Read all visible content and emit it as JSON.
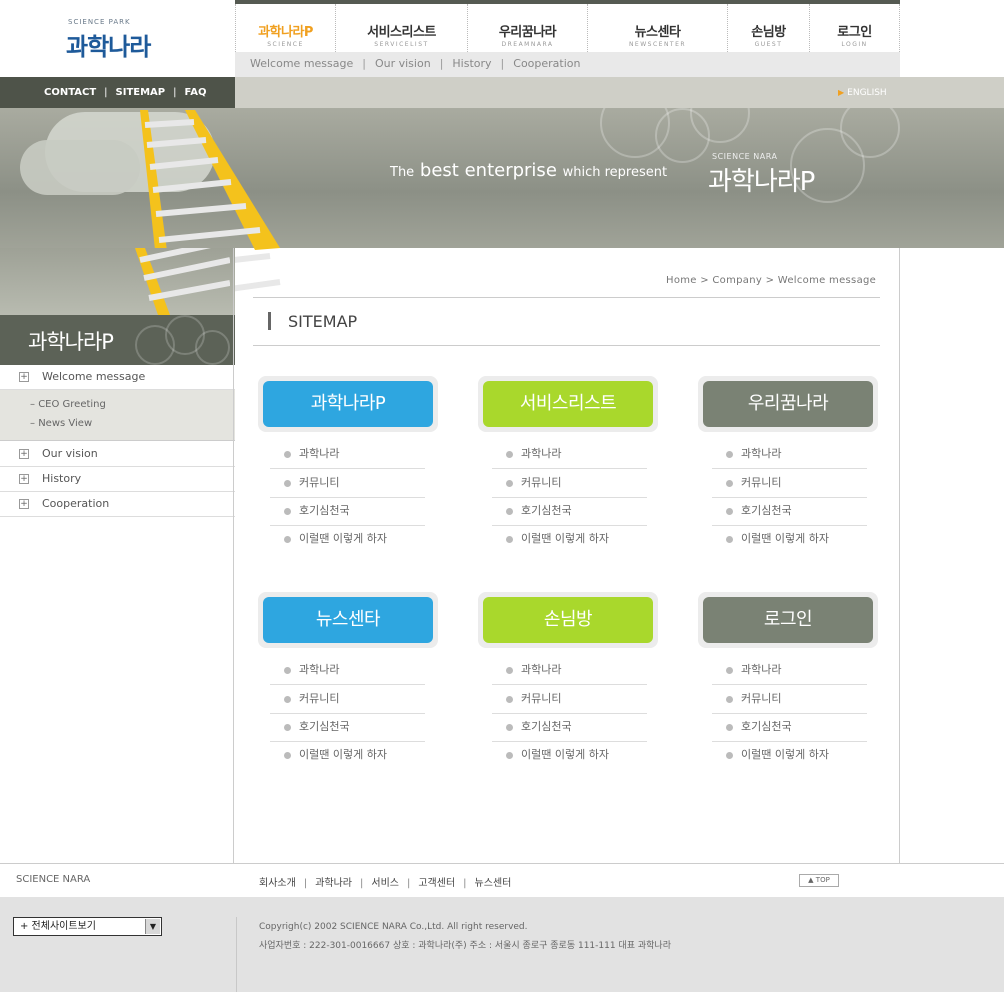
{
  "logo": {
    "small": "SCIENCE PARK",
    "main": "과학나라"
  },
  "gnb": [
    {
      "ko": "과학나라P",
      "en": "SCIENCE",
      "active": true
    },
    {
      "ko": "서비스리스트",
      "en": "SERVICELIST",
      "active": false
    },
    {
      "ko": "우리꿈나라",
      "en": "DREAMNARA",
      "active": false
    },
    {
      "ko": "뉴스센타",
      "en": "NEWSCENTER",
      "active": false
    },
    {
      "ko": "손님방",
      "en": "GUEST",
      "active": false
    },
    {
      "ko": "로그인",
      "en": "LOGIN",
      "active": false
    }
  ],
  "subnav": [
    "Welcome message",
    "Our vision",
    "History",
    "Cooperation"
  ],
  "toplinks": [
    "CONTACT",
    "SITEMAP",
    "FAQ"
  ],
  "english": "ENGLISH",
  "banner": {
    "the": "The",
    "best": "best",
    "enterprise": "enterprise",
    "which": "which represent",
    "brand_small": "SCIENCE NARA",
    "brand": "과학나라P"
  },
  "left": {
    "title": "과학나라P",
    "menu": [
      "Welcome message",
      "Our vision",
      "History",
      "Cooperation"
    ],
    "submenu": [
      "CEO Greeting",
      "News View"
    ]
  },
  "breadcrumb": {
    "home": "Home",
    "company": "Company",
    "current": "Welcome message"
  },
  "page_title": "SITEMAP",
  "cards": [
    {
      "title": "과학나라P",
      "color": "#2ea6e0"
    },
    {
      "title": "서비스리스트",
      "color": "#a9d82c"
    },
    {
      "title": "우리꿈나라",
      "color": "#7a8274"
    },
    {
      "title": "뉴스센타",
      "color": "#2ea6e0"
    },
    {
      "title": "손님방",
      "color": "#a9d82c"
    },
    {
      "title": "로그인",
      "color": "#7a8274"
    }
  ],
  "card_items": [
    "과학나라",
    "커뮤니티",
    "호기심천국",
    "이럴땐 이렇게 하자"
  ],
  "footer": {
    "brand": "SCIENCE NARA",
    "links": [
      "회사소개",
      "과학나라",
      "서비스",
      "고객센터",
      "뉴스센터"
    ],
    "top": "TOP",
    "select": "+ 전체사이트보기",
    "copyright": "Copyrigh(c) 2002 SCIENCE NARA Co.,Ltd. All right reserved.",
    "address": "사업자번호 : 222-301-0016667 상호 : 과학나라(주)  주소 : 서울시 종로구 종로동 111-111 대표 과학나라"
  }
}
